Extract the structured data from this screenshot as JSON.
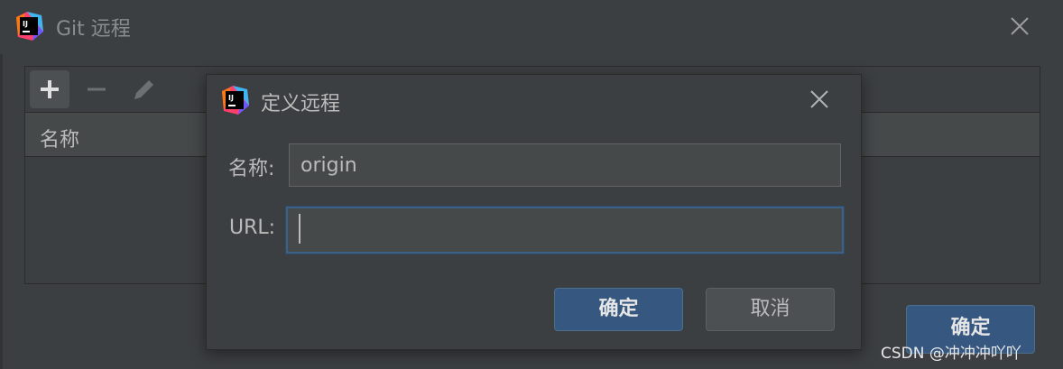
{
  "outer_window": {
    "title": "Git 远程",
    "app_icon": "intellij-idea-icon",
    "close_icon": "close-icon",
    "toolbar": {
      "add_icon": "plus-icon",
      "remove_icon": "minus-icon",
      "edit_icon": "pencil-icon"
    },
    "table": {
      "columns": [
        "名称"
      ]
    },
    "ok_label": "确定"
  },
  "dialog": {
    "title": "定义远程",
    "app_icon": "intellij-idea-icon",
    "close_icon": "close-icon",
    "name_label": "名称:",
    "name_value": "origin",
    "url_label": "URL:",
    "url_value": "",
    "ok_label": "确定",
    "cancel_label": "取消"
  },
  "watermark": "CSDN @冲冲冲吖吖",
  "colors": {
    "background": "#3c3f41",
    "accent_button": "#365880",
    "focus_border": "#3d6185"
  }
}
